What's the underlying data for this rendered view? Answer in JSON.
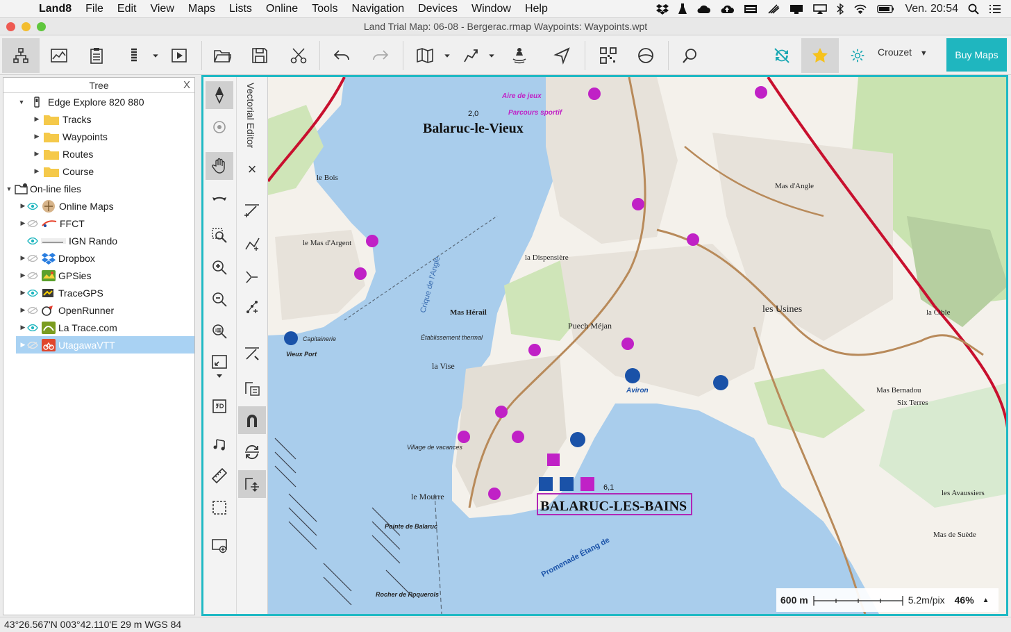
{
  "menubar": {
    "app": "Land8",
    "items": [
      "File",
      "Edit",
      "View",
      "Maps",
      "Lists",
      "Online",
      "Tools",
      "Navigation",
      "Devices",
      "Window",
      "Help"
    ],
    "clock": "Ven. 20:54"
  },
  "window": {
    "title": "Land Trial Map: 06-08 - Bergerac.rmap Waypoints:  Waypoints.wpt"
  },
  "toolbar": {
    "profile_label": "Crouzet",
    "buy_label": "Buy Maps"
  },
  "tree": {
    "title": "Tree",
    "close": "X",
    "device": "Edge Explore 820 880",
    "device_children": [
      "Tracks",
      "Waypoints",
      "Routes",
      "Course"
    ],
    "online_root": "On-line files",
    "online_items": [
      "Online Maps",
      "FFCT",
      "IGN Rando",
      "Dropbox",
      "GPSies",
      "TraceGPS",
      "OpenRunner",
      "La Trace.com",
      "UtagawaVTT"
    ],
    "selected": "UtagawaVTT"
  },
  "vector_editor": {
    "title": "Vectorial Editor",
    "close": "×"
  },
  "map": {
    "labels": {
      "balaruc_vieux": "Balaruc-le-Vieux",
      "balaruc_bains": "BALARUC-LES-BAINS",
      "aire_jeux": "Aire de jeux",
      "parcours": "Parcours sportif",
      "le_bois": "le Bois",
      "mas_argent": "le Mas d'Argent",
      "dispensiere": "la Dispensière",
      "puech_mejan": "Puech Méjan",
      "mas_herail": "Mas Hérail",
      "la_vise": "la Vise",
      "le_mourre": "le Mourre",
      "pointe_balaruc": "Pointe de Balaruc",
      "rocher_roquerols": "Rocher de Roquerols",
      "crique": "Crique de l'Angle",
      "mas_angle": "Mas d'Angle",
      "les_usines": "les Usines",
      "la_cible": "la Cible",
      "mas_bernadou": "Mas Bernadou",
      "six_terres": "Six Terres",
      "mas_suede": "Mas de Suède",
      "les_avaussiers": "les Avaussiers",
      "avirons": "Aviron",
      "capitainerie": "Capitainerie",
      "vieux_port": "Vieux Port",
      "etab_thermal": "Établissement thermal",
      "village_vacances": "Village de vacances",
      "alt_20": "2,0",
      "alt_61": "6,1",
      "promenade": "Promenade Étang de"
    }
  },
  "scale": {
    "distance": "600 m",
    "resolution": "5.2m/pix",
    "zoom": "46%"
  },
  "status": {
    "coords": "43°26.567'N 003°42.110'E  29 m  WGS 84"
  },
  "colors": {
    "accent": "#1fb6bf",
    "water": "#a9cdec",
    "land": "#f6f3ee",
    "forest": "#c9e3b0",
    "road_main": "#c8102e",
    "poi": "#c021c6"
  }
}
